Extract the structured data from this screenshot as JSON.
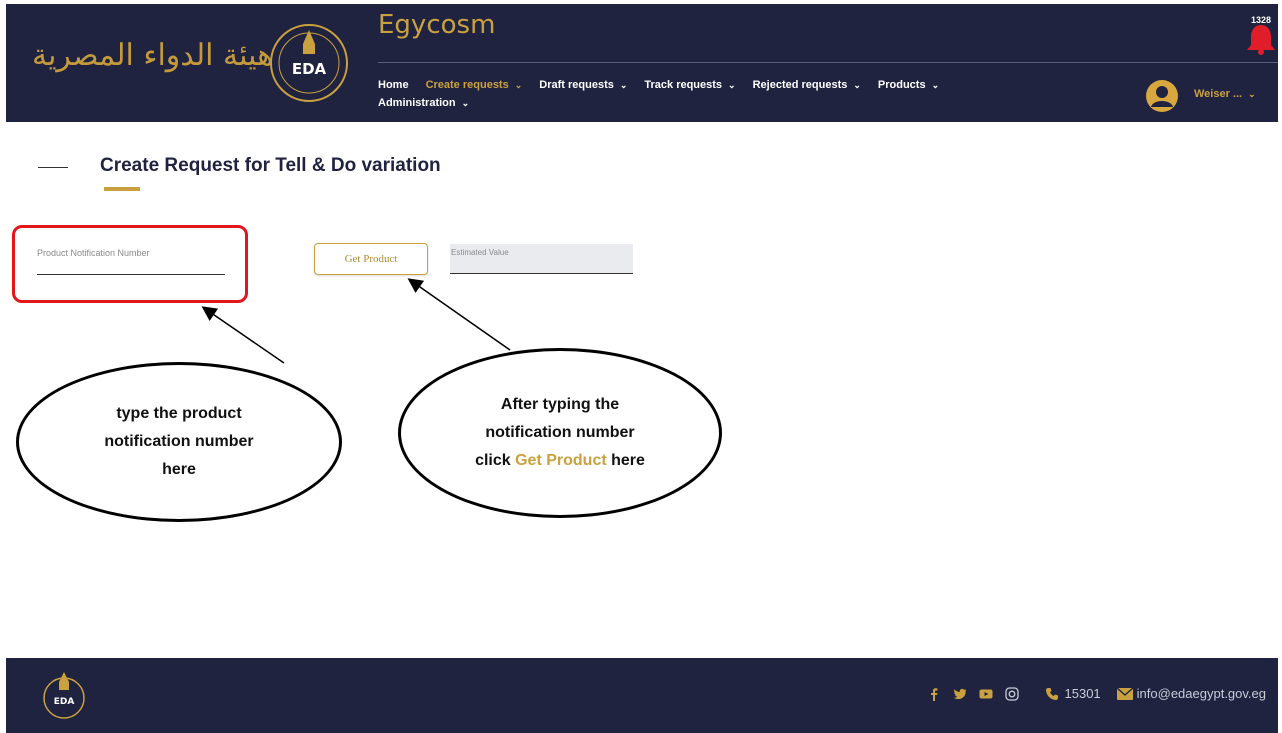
{
  "header": {
    "arabic_logo_text": "هيئة الدواء المصرية",
    "eda_logo_text": "EDA",
    "app_title": "Egycosm",
    "notification_count": "1328",
    "user_name": "Weiser ...",
    "nav": [
      {
        "label": "Home",
        "has_dropdown": false,
        "active": false
      },
      {
        "label": "Create requests",
        "has_dropdown": true,
        "active": true
      },
      {
        "label": "Draft requests",
        "has_dropdown": true,
        "active": false
      },
      {
        "label": "Track requests",
        "has_dropdown": true,
        "active": false
      },
      {
        "label": "Rejected requests",
        "has_dropdown": true,
        "active": false
      },
      {
        "label": "Products",
        "has_dropdown": true,
        "active": false
      },
      {
        "label": "Administration",
        "has_dropdown": true,
        "active": false
      }
    ]
  },
  "page": {
    "title": "Create Request for Tell & Do variation"
  },
  "form": {
    "product_notification_label": "Product Notification Number",
    "product_notification_value": "",
    "get_product_label": "Get Product",
    "estimated_value_label": "Estimated Value",
    "estimated_value": ""
  },
  "callouts": {
    "left": [
      "type the product",
      "notification number",
      "here"
    ],
    "right_line1": "After typing the",
    "right_line2": "notification number",
    "right_line3_prefix": "click ",
    "right_line3_highlight": "Get Product",
    "right_line3_suffix": " here"
  },
  "footer": {
    "phone": "15301",
    "email": "info@edaegypt.gov.eg",
    "social_icons": [
      "facebook-icon",
      "twitter-icon",
      "youtube-icon",
      "instagram-icon"
    ]
  },
  "colors": {
    "navy": "#1f2340",
    "gold": "#c9a13f",
    "highlight_red": "#e3161c",
    "notification_red": "#e11d2a"
  }
}
